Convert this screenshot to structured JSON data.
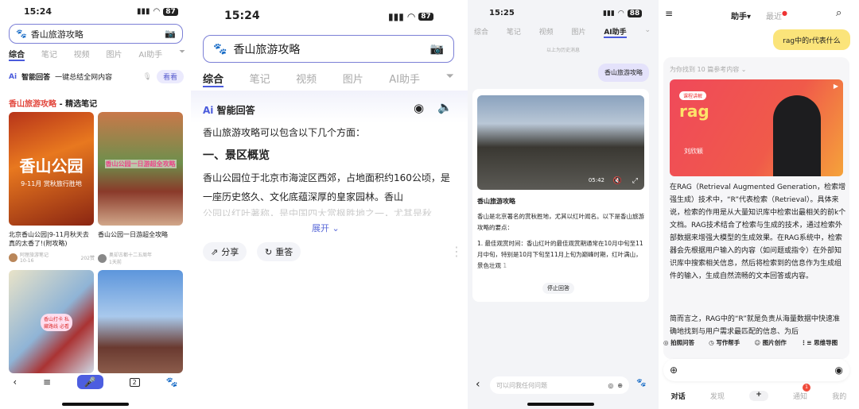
{
  "p1": {
    "time": "15:24",
    "battery": "87",
    "query": "香山旅游攻略",
    "tabs": [
      "综合",
      "笔记",
      "视频",
      "图片",
      "AI助手"
    ],
    "ai_label": "智能回答",
    "ai_desc": "一键总结全网内容",
    "ai_btn": "看看",
    "section_hl": "香山旅游攻略",
    "section_rest": " - 精选笔记",
    "cards": [
      {
        "cover": "香山公园",
        "cover_sub": "9-11月 赏秋旅行胜地",
        "title": "北京香山公园|9-11月秋天去真的太香了!(附攻略)",
        "author": "阿狸旅游笔记",
        "date": "10-16",
        "likes": "202赞"
      },
      {
        "cover": "香山公园一日游超全攻略",
        "title": "香山公园一日游超全攻略",
        "author": "奥却古都十二五周年",
        "date": "1天前"
      }
    ],
    "sticker": "香山打卡 私藏路线 必看",
    "tab_count": "2"
  },
  "p2": {
    "time": "15:24",
    "battery": "87",
    "query": "香山旅游攻略",
    "tabs": [
      "综合",
      "笔记",
      "视频",
      "图片",
      "AI助手"
    ],
    "ai_label": "智能回答",
    "intro": "香山旅游攻略可以包含以下几个方面：",
    "heading": "一、景区概览",
    "body": "香山公园位于北京市海淀区西郊，占地面积约160公顷，是一座历史悠久、文化底蕴深厚的皇家园林。香山",
    "faded": "公园以红叶著称，是中国四大赏枫胜地之一，尤其是秋",
    "expand": "展开",
    "share": "分享",
    "retry": "重答"
  },
  "p3": {
    "time": "15:25",
    "battery": "88",
    "tabs": [
      "综合",
      "笔记",
      "视频",
      "图片",
      "AI助手"
    ],
    "history": "以上为历史消息",
    "user_msg": "香山旅游攻略",
    "video_time": "05:42",
    "title": "香山旅游攻略",
    "para": "香山是北京著名的赏秋胜地，尤其以红叶闻名。以下是香山旅游攻略的要点：",
    "item": "1. 最佳观赏时间：香山红叶的最佳观赏期通常在10月中旬至11月中旬，特别是10月下旬至11月上旬为巅峰时期，红叶满山，景色壮观",
    "cite": "1",
    "stop": "停止回答",
    "placeholder": "可以问我任何问题"
  },
  "p4": {
    "assistant": "助手",
    "recent": "最近",
    "user_msg": "rag中的r代表什么",
    "refs": "为你找到 10 篇参考内容",
    "cover_tag": "课程讲解",
    "cover_word": "rag",
    "cover_name": "刘欣颖",
    "answer1": "在RAG（Retrieval Augmented Generation，检索增强生成）技术中，“R”代表检索（Retrieval）。具体来说，检索的作用是从大量知识库中检索出最相关的前k个文档。RAG技术结合了检索与生成的技术，通过检索外部数据来增强大模型的生成效果。在RAG系统中，检索器会先根据用户输入的内容（如问题或指令）在外部知识库中搜索相关信息，然后将检索到的信息作为生成组件的输入，生成自然流畅的文本回答或内容。",
    "answer2": "简而言之，RAG中的“R”就是负责从海量数据中快速准确地找到与用户需求最匹配的信息、为后",
    "tools": [
      "拍照问答",
      "写作帮手",
      "图片创作",
      "思维导图"
    ],
    "nav": [
      "对话",
      "发现",
      "+",
      "通知",
      "我的"
    ],
    "badge": "1"
  }
}
